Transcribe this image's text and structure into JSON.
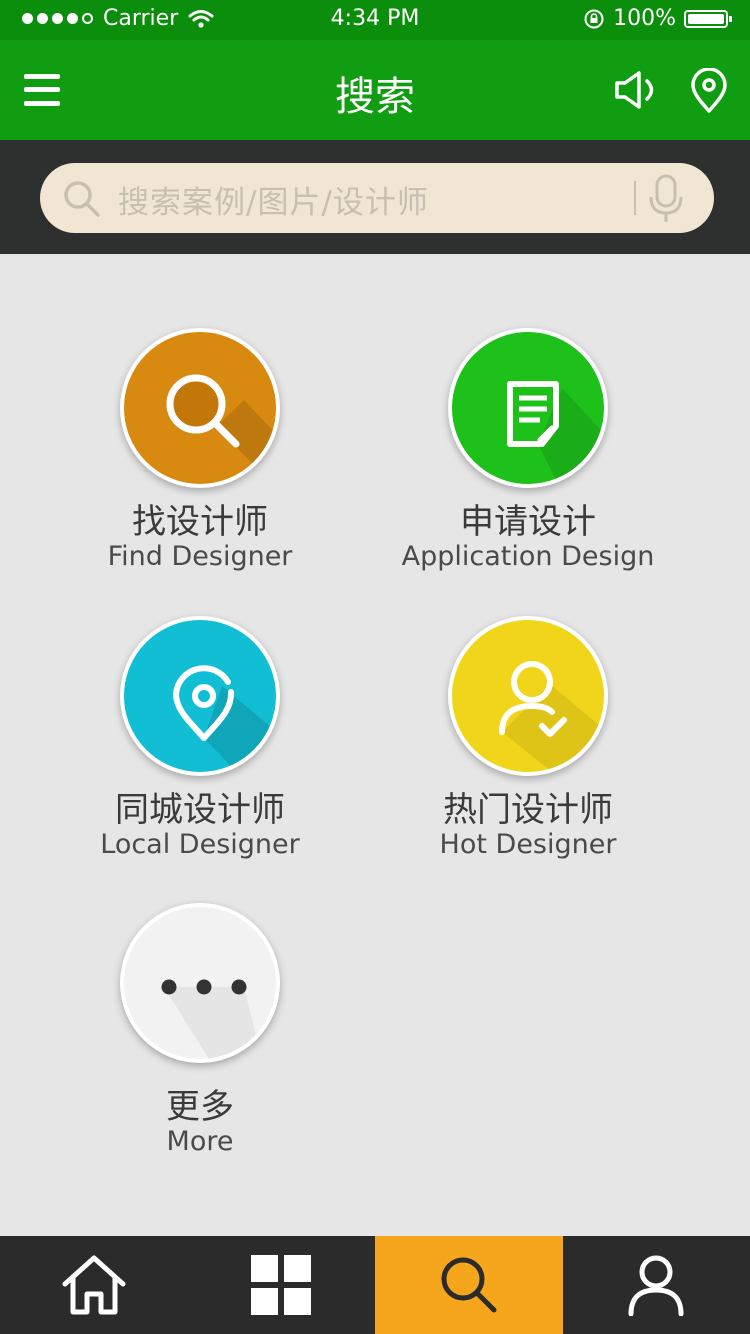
{
  "status_bar": {
    "carrier": "Carrier",
    "time": "4:34 PM",
    "battery": "100%"
  },
  "header": {
    "title": "搜索"
  },
  "search": {
    "placeholder": "搜索案例/图片/设计师"
  },
  "categories": [
    {
      "name_cn": "找设计师",
      "name_en": "Find Designer",
      "color": "#d88a10",
      "icon": "search-icon"
    },
    {
      "name_cn": "申请设计",
      "name_en": "Application Design",
      "color": "#1ec11a",
      "icon": "document-icon"
    },
    {
      "name_cn": "同城设计师",
      "name_en": "Local Designer",
      "color": "#12bed3",
      "icon": "location-pin-icon"
    },
    {
      "name_cn": "热门设计师",
      "name_en": "Hot Designer",
      "color": "#f1d51a",
      "icon": "user-check-icon"
    },
    {
      "name_cn": "更多",
      "name_en": "More",
      "color": "#f2f2f2",
      "icon": "more-dots-icon"
    }
  ],
  "tabbar": {
    "items": [
      {
        "name": "home",
        "icon": "home-icon"
      },
      {
        "name": "apps",
        "icon": "grid-icon"
      },
      {
        "name": "search",
        "icon": "search-icon",
        "active": true
      },
      {
        "name": "profile",
        "icon": "user-icon"
      }
    ],
    "active_color": "#f5a61c"
  },
  "colors": {
    "status_bar": "#0b8e0b",
    "nav_bar": "#119d11",
    "search_area": "#2d302e",
    "search_box": "#f1e6d3",
    "background": "#e6e6e6"
  }
}
